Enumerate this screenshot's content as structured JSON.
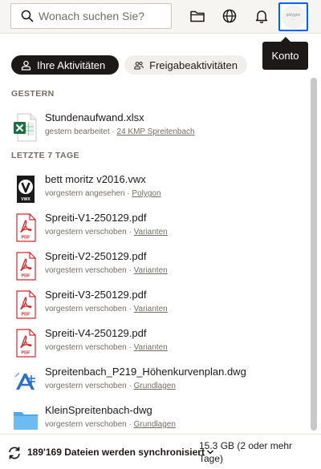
{
  "search": {
    "placeholder": "Wonach suchen Sie?"
  },
  "topbar": {
    "icons": [
      "folder-icon",
      "globe-icon",
      "bell-icon"
    ],
    "avatar_text": "polygon"
  },
  "tooltip": {
    "label": "Konto"
  },
  "tabs": [
    {
      "label": "Ihre Aktivitäten",
      "active": true,
      "icon": "user-icon"
    },
    {
      "label": "Freigabeaktivitäten",
      "active": false,
      "icon": "users-icon"
    }
  ],
  "sections": [
    {
      "header": "GESTERN",
      "files": [
        {
          "name": "Stundenaufwand.xlsx",
          "action": "gestern bearbeitet",
          "sep": " · ",
          "folder": "24 KMP Spreitenbach",
          "icon": "excel-icon"
        }
      ]
    },
    {
      "header": "LETZTE 7 TAGE",
      "files": [
        {
          "name": "bett moritz v2016.vwx",
          "action": "vorgestern angesehen",
          "sep": " · ",
          "folder": "Polygon",
          "icon": "vectorworks-icon"
        },
        {
          "name": "Spreiti-V1-250129.pdf",
          "action": "vorgestern verschoben",
          "sep": " · ",
          "folder": "Varianten",
          "icon": "pdf-icon"
        },
        {
          "name": "Spreiti-V2-250129.pdf",
          "action": "vorgestern verschoben",
          "sep": " · ",
          "folder": "Varianten",
          "icon": "pdf-icon"
        },
        {
          "name": "Spreiti-V3-250129.pdf",
          "action": "vorgestern verschoben",
          "sep": " · ",
          "folder": "Varianten",
          "icon": "pdf-icon"
        },
        {
          "name": "Spreiti-V4-250129.pdf",
          "action": "vorgestern verschoben",
          "sep": " · ",
          "folder": "Varianten",
          "icon": "pdf-icon"
        },
        {
          "name": "Spreitenbach_P219_Höhenkurvenplan.dwg",
          "action": "vorgestern verschoben",
          "sep": " · ",
          "folder": "Grundlagen",
          "icon": "dwg-icon"
        },
        {
          "name": "KleinSpreitenbach-dwg",
          "action": "vorgestern verschoben",
          "sep": " · ",
          "folder": "Grundlagen",
          "icon": "folder-blue-icon"
        }
      ]
    }
  ],
  "status": {
    "sync_text": "189'169 Dateien werden synchronisiert",
    "storage_text": "15.3 GB (2 oder mehr Tage)"
  },
  "pdf_badge": "PDF",
  "vwx_badge": "VWX",
  "colors": {
    "accent": "#0061fe",
    "pdf_red": "#d8262a",
    "excel_green": "#1d7044",
    "folder_blue": "#4aa8e8"
  }
}
